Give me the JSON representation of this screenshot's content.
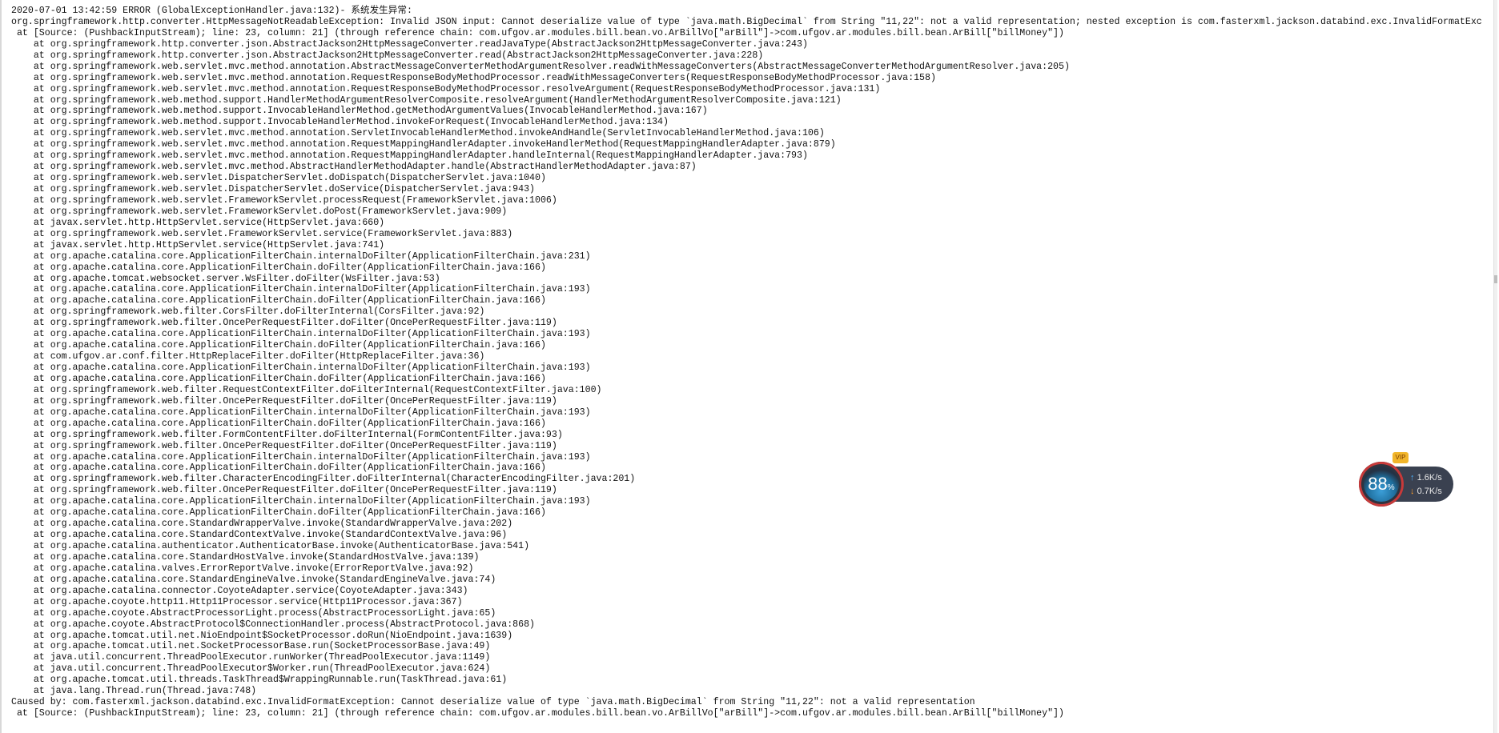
{
  "log": {
    "lines": [
      "2020-07-01 13:42:59 ERROR (GlobalExceptionHandler.java:132)- 系统发生异常:",
      "org.springframework.http.converter.HttpMessageNotReadableException: Invalid JSON input: Cannot deserialize value of type `java.math.BigDecimal` from String \"11,22\": not a valid representation; nested exception is com.fasterxml.jackson.databind.exc.InvalidFormatExc",
      " at [Source: (PushbackInputStream); line: 23, column: 21] (through reference chain: com.ufgov.ar.modules.bill.bean.vo.ArBillVo[\"arBill\"]->com.ufgov.ar.modules.bill.bean.ArBill[\"billMoney\"])",
      "    at org.springframework.http.converter.json.AbstractJackson2HttpMessageConverter.readJavaType(AbstractJackson2HttpMessageConverter.java:243)",
      "    at org.springframework.http.converter.json.AbstractJackson2HttpMessageConverter.read(AbstractJackson2HttpMessageConverter.java:228)",
      "    at org.springframework.web.servlet.mvc.method.annotation.AbstractMessageConverterMethodArgumentResolver.readWithMessageConverters(AbstractMessageConverterMethodArgumentResolver.java:205)",
      "    at org.springframework.web.servlet.mvc.method.annotation.RequestResponseBodyMethodProcessor.readWithMessageConverters(RequestResponseBodyMethodProcessor.java:158)",
      "    at org.springframework.web.servlet.mvc.method.annotation.RequestResponseBodyMethodProcessor.resolveArgument(RequestResponseBodyMethodProcessor.java:131)",
      "    at org.springframework.web.method.support.HandlerMethodArgumentResolverComposite.resolveArgument(HandlerMethodArgumentResolverComposite.java:121)",
      "    at org.springframework.web.method.support.InvocableHandlerMethod.getMethodArgumentValues(InvocableHandlerMethod.java:167)",
      "    at org.springframework.web.method.support.InvocableHandlerMethod.invokeForRequest(InvocableHandlerMethod.java:134)",
      "    at org.springframework.web.servlet.mvc.method.annotation.ServletInvocableHandlerMethod.invokeAndHandle(ServletInvocableHandlerMethod.java:106)",
      "    at org.springframework.web.servlet.mvc.method.annotation.RequestMappingHandlerAdapter.invokeHandlerMethod(RequestMappingHandlerAdapter.java:879)",
      "    at org.springframework.web.servlet.mvc.method.annotation.RequestMappingHandlerAdapter.handleInternal(RequestMappingHandlerAdapter.java:793)",
      "    at org.springframework.web.servlet.mvc.method.AbstractHandlerMethodAdapter.handle(AbstractHandlerMethodAdapter.java:87)",
      "    at org.springframework.web.servlet.DispatcherServlet.doDispatch(DispatcherServlet.java:1040)",
      "    at org.springframework.web.servlet.DispatcherServlet.doService(DispatcherServlet.java:943)",
      "    at org.springframework.web.servlet.FrameworkServlet.processRequest(FrameworkServlet.java:1006)",
      "    at org.springframework.web.servlet.FrameworkServlet.doPost(FrameworkServlet.java:909)",
      "    at javax.servlet.http.HttpServlet.service(HttpServlet.java:660)",
      "    at org.springframework.web.servlet.FrameworkServlet.service(FrameworkServlet.java:883)",
      "    at javax.servlet.http.HttpServlet.service(HttpServlet.java:741)",
      "    at org.apache.catalina.core.ApplicationFilterChain.internalDoFilter(ApplicationFilterChain.java:231)",
      "    at org.apache.catalina.core.ApplicationFilterChain.doFilter(ApplicationFilterChain.java:166)",
      "    at org.apache.tomcat.websocket.server.WsFilter.doFilter(WsFilter.java:53)",
      "    at org.apache.catalina.core.ApplicationFilterChain.internalDoFilter(ApplicationFilterChain.java:193)",
      "    at org.apache.catalina.core.ApplicationFilterChain.doFilter(ApplicationFilterChain.java:166)",
      "    at org.springframework.web.filter.CorsFilter.doFilterInternal(CorsFilter.java:92)",
      "    at org.springframework.web.filter.OncePerRequestFilter.doFilter(OncePerRequestFilter.java:119)",
      "    at org.apache.catalina.core.ApplicationFilterChain.internalDoFilter(ApplicationFilterChain.java:193)",
      "    at org.apache.catalina.core.ApplicationFilterChain.doFilter(ApplicationFilterChain.java:166)",
      "    at com.ufgov.ar.conf.filter.HttpReplaceFilter.doFilter(HttpReplaceFilter.java:36)",
      "    at org.apache.catalina.core.ApplicationFilterChain.internalDoFilter(ApplicationFilterChain.java:193)",
      "    at org.apache.catalina.core.ApplicationFilterChain.doFilter(ApplicationFilterChain.java:166)",
      "    at org.springframework.web.filter.RequestContextFilter.doFilterInternal(RequestContextFilter.java:100)",
      "    at org.springframework.web.filter.OncePerRequestFilter.doFilter(OncePerRequestFilter.java:119)",
      "    at org.apache.catalina.core.ApplicationFilterChain.internalDoFilter(ApplicationFilterChain.java:193)",
      "    at org.apache.catalina.core.ApplicationFilterChain.doFilter(ApplicationFilterChain.java:166)",
      "    at org.springframework.web.filter.FormContentFilter.doFilterInternal(FormContentFilter.java:93)",
      "    at org.springframework.web.filter.OncePerRequestFilter.doFilter(OncePerRequestFilter.java:119)",
      "    at org.apache.catalina.core.ApplicationFilterChain.internalDoFilter(ApplicationFilterChain.java:193)",
      "    at org.apache.catalina.core.ApplicationFilterChain.doFilter(ApplicationFilterChain.java:166)",
      "    at org.springframework.web.filter.CharacterEncodingFilter.doFilterInternal(CharacterEncodingFilter.java:201)",
      "    at org.springframework.web.filter.OncePerRequestFilter.doFilter(OncePerRequestFilter.java:119)",
      "    at org.apache.catalina.core.ApplicationFilterChain.internalDoFilter(ApplicationFilterChain.java:193)",
      "    at org.apache.catalina.core.ApplicationFilterChain.doFilter(ApplicationFilterChain.java:166)",
      "    at org.apache.catalina.core.StandardWrapperValve.invoke(StandardWrapperValve.java:202)",
      "    at org.apache.catalina.core.StandardContextValve.invoke(StandardContextValve.java:96)",
      "    at org.apache.catalina.authenticator.AuthenticatorBase.invoke(AuthenticatorBase.java:541)",
      "    at org.apache.catalina.core.StandardHostValve.invoke(StandardHostValve.java:139)",
      "    at org.apache.catalina.valves.ErrorReportValve.invoke(ErrorReportValve.java:92)",
      "    at org.apache.catalina.core.StandardEngineValve.invoke(StandardEngineValve.java:74)",
      "    at org.apache.catalina.connector.CoyoteAdapter.service(CoyoteAdapter.java:343)",
      "    at org.apache.coyote.http11.Http11Processor.service(Http11Processor.java:367)",
      "    at org.apache.coyote.AbstractProcessorLight.process(AbstractProcessorLight.java:65)",
      "    at org.apache.coyote.AbstractProtocol$ConnectionHandler.process(AbstractProtocol.java:868)",
      "    at org.apache.tomcat.util.net.NioEndpoint$SocketProcessor.doRun(NioEndpoint.java:1639)",
      "    at org.apache.tomcat.util.net.SocketProcessorBase.run(SocketProcessorBase.java:49)",
      "    at java.util.concurrent.ThreadPoolExecutor.runWorker(ThreadPoolExecutor.java:1149)",
      "    at java.util.concurrent.ThreadPoolExecutor$Worker.run(ThreadPoolExecutor.java:624)",
      "    at org.apache.tomcat.util.threads.TaskThread$WrappingRunnable.run(TaskThread.java:61)",
      "    at java.lang.Thread.run(Thread.java:748)",
      "Caused by: com.fasterxml.jackson.databind.exc.InvalidFormatException: Cannot deserialize value of type `java.math.BigDecimal` from String \"11,22\": not a valid representation",
      " at [Source: (PushbackInputStream); line: 23, column: 21] (through reference chain: com.ufgov.ar.modules.bill.bean.vo.ArBillVo[\"arBill\"]->com.ufgov.ar.modules.bill.bean.ArBill[\"billMoney\"])"
    ]
  },
  "net_monitor": {
    "percent": "88",
    "percent_unit": "%",
    "vip_label": "VIP",
    "upload_rate": "1.6K/s",
    "download_rate": "0.7K/s",
    "colors": {
      "ring": "#c73a3a",
      "up": "#4fb3ff",
      "down": "#ff9f2a"
    }
  }
}
